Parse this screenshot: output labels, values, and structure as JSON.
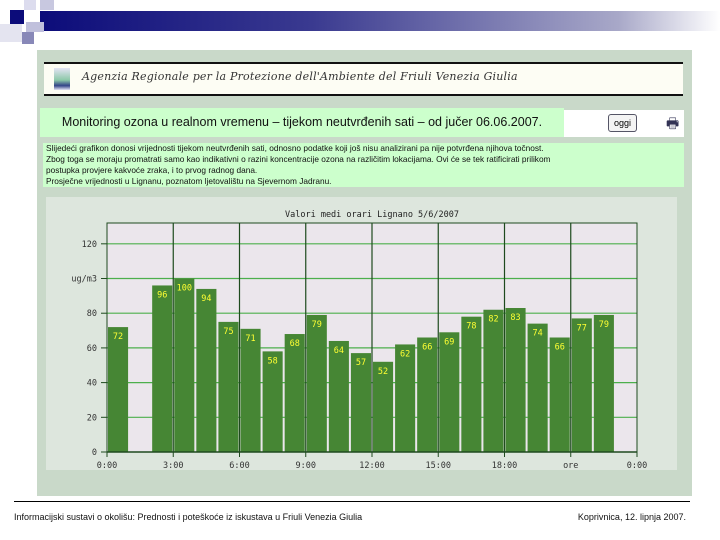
{
  "header": {
    "agency_name": "Agenzia Regionale per la Protezione dell'Ambiente del Friuli Venezia Giulia"
  },
  "title": "Monitoring ozona u realnom vremenu – tijekom neutvrđenih sati – od jučer 06.06.2007.",
  "toolbar": {
    "today_button": "oggi",
    "print_icon": "printer-icon"
  },
  "description": [
    "Slijedeći grafikon donosi vrijednosti tijekom neutvrđenih sati, odnosno podatke koji još nisu analizirani pa nije potvrđena njihova točnost.",
    "Zbog toga se moraju promatrati samo kao indikativni o razini koncentracije ozona na različitim lokacijama. Ovi će se tek ratificirati prilikom",
    "postupka provjere kakvoće zraka, i to prvog radnog dana.",
    "Prosječne vrijednosti u Lignanu, poznatom ljetovalištu na Sjevernom Jadranu."
  ],
  "chart_data": {
    "type": "bar",
    "title": "Valori medi orari    Lignano    5/6/2007",
    "ylabel": "ug/m3",
    "xlabel": "",
    "ylim": [
      0,
      132
    ],
    "yticks": [
      {
        "v": 0,
        "label": "0"
      },
      {
        "v": 20,
        "label": "20"
      },
      {
        "v": 40,
        "label": "40"
      },
      {
        "v": 60,
        "label": "60"
      },
      {
        "v": 80,
        "label": "80"
      },
      {
        "v": 100,
        "label": "ug/m3"
      },
      {
        "v": 120,
        "label": "120"
      }
    ],
    "xlim": [
      0,
      24
    ],
    "xticks": [
      {
        "v": 0,
        "label": "0:00"
      },
      {
        "v": 3,
        "label": "3:00"
      },
      {
        "v": 6,
        "label": "6:00"
      },
      {
        "v": 9,
        "label": "9:00"
      },
      {
        "v": 12,
        "label": "12:00"
      },
      {
        "v": 15,
        "label": "15:00"
      },
      {
        "v": 18,
        "label": "18:00"
      },
      {
        "v": 21,
        "label": "ore"
      },
      {
        "v": 24,
        "label": "0:00"
      }
    ],
    "hours": [
      0,
      2,
      3,
      4,
      5,
      6,
      7,
      8,
      9,
      10,
      11,
      12,
      13,
      14,
      15,
      16,
      17,
      18,
      19,
      20,
      21,
      22
    ],
    "values": [
      72,
      96,
      100,
      94,
      75,
      71,
      58,
      68,
      79,
      64,
      57,
      52,
      62,
      66,
      69,
      78,
      82,
      83,
      74,
      66,
      77,
      79
    ],
    "grid": true,
    "colors": {
      "bar": "#468634",
      "label": "#ffff33",
      "plot_bg": "#ebe6ec",
      "grid_h": "#4caf4c",
      "grid_v": "#1e4a1e"
    }
  },
  "footer": {
    "left": "Informacijski sustavi o okolišu: Prednosti i poteškoće iz iskustava u Friuli Venezia Giulia",
    "right": "Koprivnica, 12. lipnja 2007."
  }
}
